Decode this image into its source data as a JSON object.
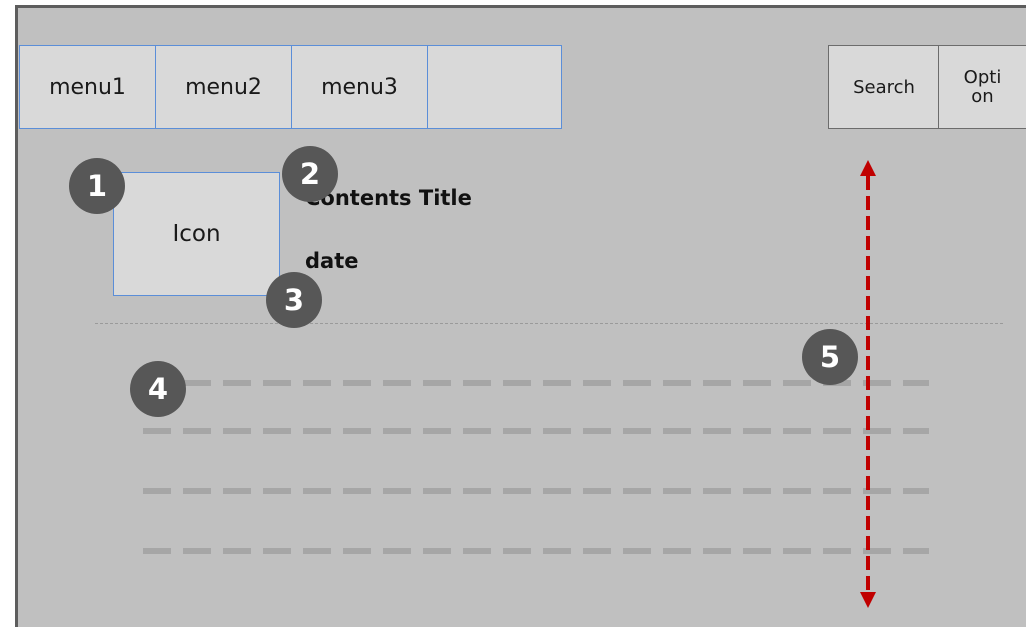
{
  "menu": {
    "items": [
      {
        "label": "menu1"
      },
      {
        "label": "menu2"
      },
      {
        "label": "menu3"
      },
      {
        "label": ""
      }
    ]
  },
  "toolbar": {
    "search_label": "Search",
    "option_label": "Option"
  },
  "content": {
    "icon_label": "Icon",
    "title": "Contents Title",
    "date": "date"
  },
  "annotations": [
    "1",
    "2",
    "3",
    "4",
    "5"
  ],
  "colors": {
    "background": "#c0c0c0",
    "frame_border": "#5d5d5d",
    "box_fill": "#d9d9d9",
    "box_border": "#5b8ed8",
    "badge": "#575757",
    "scroll_arrow": "#c00000",
    "placeholder_line": "#a6a6a6"
  }
}
